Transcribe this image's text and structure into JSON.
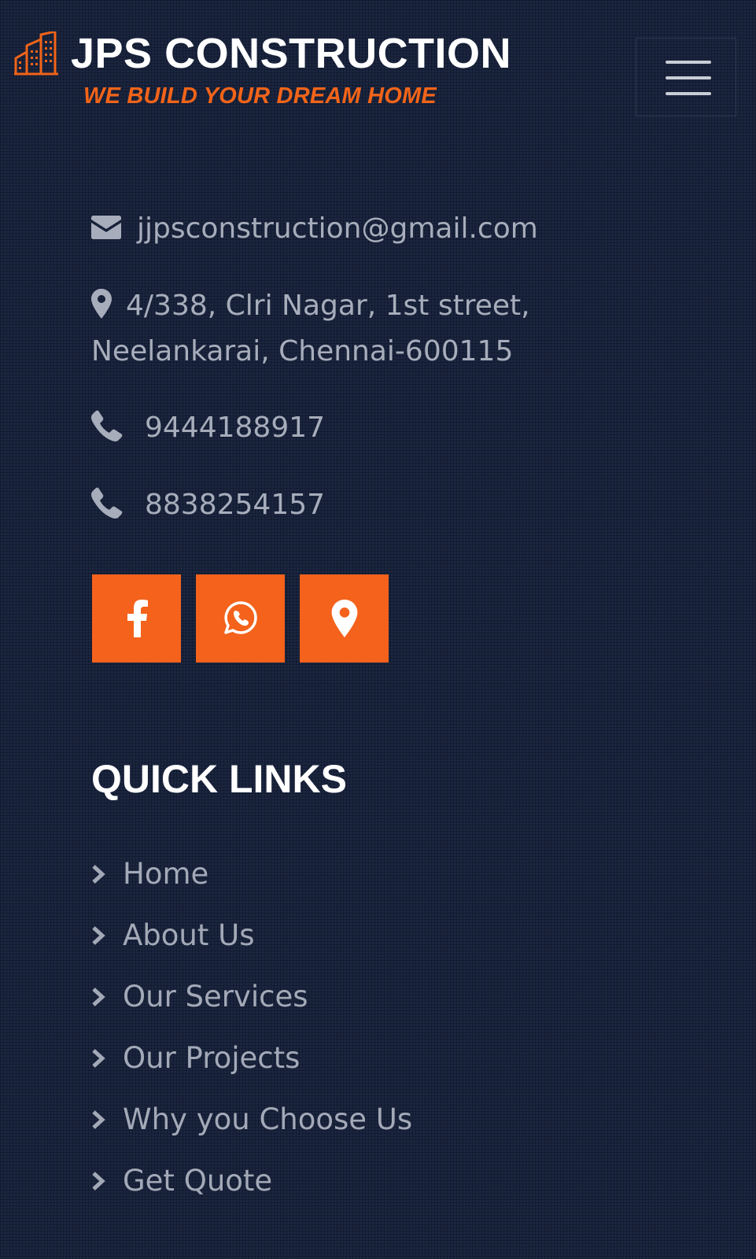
{
  "header": {
    "brand_title": "JPS CONSTRUCTION",
    "tagline": "WE BUILD YOUR DREAM HOME",
    "logo_icon": "building-icon",
    "menu_icon": "hamburger-menu-icon"
  },
  "contact": {
    "email": "jjpsconstruction@gmail.com",
    "address_line1": "4/338, Clri Nagar, 1st street,",
    "address_line2": "Neelankarai, Chennai-600115",
    "phone_1": "9444188917",
    "phone_2": "8838254157",
    "icons": [
      "envelope-icon",
      "map-marker-icon",
      "phone-icon"
    ]
  },
  "social": {
    "buttons": [
      "facebook-icon",
      "whatsapp-icon",
      "map-marker-icon"
    ]
  },
  "quick_links": {
    "title": "QUICK LINKS",
    "items": [
      {
        "label": "Home"
      },
      {
        "label": "About Us"
      },
      {
        "label": "Our Services"
      },
      {
        "label": "Our Projects"
      },
      {
        "label": "Why you Choose Us"
      },
      {
        "label": "Get Quote"
      }
    ]
  },
  "colors": {
    "background": "#1b2640",
    "accent": "#f4621b",
    "text_muted": "#a7adbb",
    "heading": "#ffffff"
  }
}
